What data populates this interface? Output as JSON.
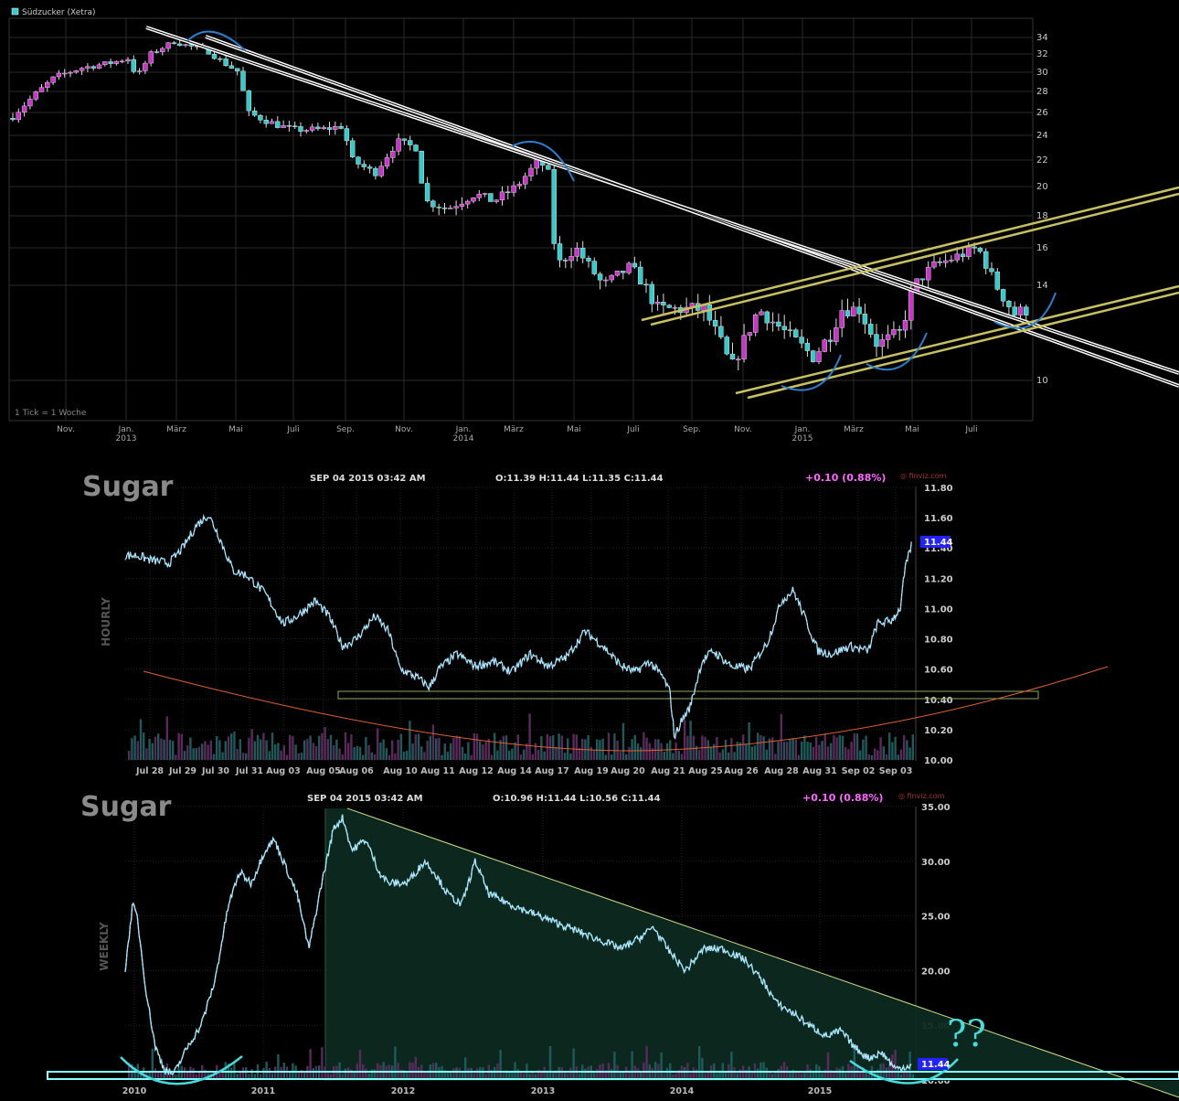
{
  "panel1": {
    "legend": "Südzucker (Xetra)",
    "note": "1 Tick = 1 Woche",
    "y_ticks": [
      "34",
      "32",
      "30",
      "28",
      "26",
      "24",
      "22",
      "20",
      "18",
      "16",
      "14",
      "10"
    ],
    "x_ticks": [
      "Nov.",
      "Jan.",
      "März",
      "Mai",
      "Juli",
      "Sep.",
      "Nov.",
      "Jan.",
      "März",
      "Mai",
      "Juli",
      "Sep.",
      "Nov.",
      "Jan.",
      "März",
      "Mai",
      "Juli"
    ],
    "x_years": [
      "2013",
      "2014",
      "2015"
    ]
  },
  "panel2": {
    "title": "Sugar",
    "date": "SEP 04 2015 03:42 AM",
    "ohlc": "O:11.39    H:11.44    L:11.35    C:11.44",
    "change": "+0.10 (0.88%)",
    "brand": "finviz.com",
    "side_label": "HOURLY",
    "last_badge": "11.44",
    "y_ticks": [
      "11.80",
      "11.60",
      "11.40",
      "11.20",
      "11.00",
      "10.80",
      "10.60",
      "10.40",
      "10.20",
      "10.00"
    ],
    "x_ticks": [
      "Jul 28",
      "Jul 29",
      "Jul 30",
      "Jul 31",
      "Aug 03",
      "Aug 05",
      "Aug 06",
      "Aug 10",
      "Aug 11",
      "Aug 12",
      "Aug 14",
      "Aug 17",
      "Aug 19",
      "Aug 20",
      "Aug 21",
      "Aug 25",
      "Aug 26",
      "Aug 28",
      "Aug 31",
      "Sep 02",
      "Sep 03"
    ]
  },
  "panel3": {
    "title": "Sugar",
    "date": "SEP 04 2015 03:42 AM",
    "ohlc": "O:10.96    H:11.44    L:10.56    C:11.44",
    "change": "+0.10 (0.88%)",
    "brand": "finviz.com",
    "side_label": "WEEKLY",
    "last_badge": "11.44",
    "annotation": "??",
    "y_ticks": [
      "35.00",
      "30.00",
      "25.00",
      "20.00",
      "15.00",
      "10.00"
    ],
    "x_ticks": [
      "2010",
      "2011",
      "2012",
      "2013",
      "2014",
      "2015"
    ]
  },
  "colors": {
    "up": "#ff66ff",
    "down": "#66ffff",
    "cyan_candle": "#3cc",
    "magenta_candle": "#c3c",
    "trend_white": "#ffffff",
    "channel_yellow": "#c8c060",
    "curve_blue": "#2a7fd0",
    "support_green": "#88aa66",
    "parabola": "#e06030",
    "change_text": "#ff66ff"
  },
  "chart_data": [
    {
      "type": "candlestick",
      "title": "Südzucker (Xetra)",
      "ylim": [
        9,
        35
      ],
      "x": [
        "Nov. 2012",
        "Jan. 2013",
        "März",
        "Mai",
        "Juli",
        "Sep.",
        "Nov.",
        "Jan. 2014",
        "März",
        "Mai",
        "Juli",
        "Sep.",
        "Nov.",
        "Jan. 2015",
        "März",
        "Mai",
        "Juli",
        "Sep."
      ],
      "values": [
        25.5,
        31,
        33.5,
        28,
        25,
        22,
        23,
        19,
        22,
        15,
        14,
        13,
        10.5,
        11,
        13,
        14,
        16,
        12.5
      ]
    },
    {
      "type": "line",
      "title": "Sugar",
      "ylim": [
        10.0,
        11.8
      ],
      "x": [
        "Jul 28",
        "Jul 29",
        "Jul 30",
        "Jul 31",
        "Aug 03",
        "Aug 05",
        "Aug 06",
        "Aug 10",
        "Aug 11",
        "Aug 12",
        "Aug 14",
        "Aug 17",
        "Aug 19",
        "Aug 20",
        "Aug 21",
        "Aug 25",
        "Aug 26",
        "Aug 28",
        "Aug 31",
        "Sep 02",
        "Sep 03"
      ],
      "values": [
        11.35,
        11.3,
        11.6,
        11.25,
        10.9,
        10.95,
        10.75,
        10.85,
        10.5,
        10.65,
        10.62,
        10.68,
        10.7,
        10.55,
        10.25,
        10.65,
        10.6,
        11.1,
        10.7,
        10.8,
        11.44
      ]
    },
    {
      "type": "line",
      "title": "Sugar",
      "ylim": [
        10.0,
        35.0
      ],
      "x": [
        "2010",
        "2011",
        "2012",
        "2013",
        "2014",
        "2015"
      ],
      "values": [
        26,
        13,
        33,
        28,
        24,
        18,
        14,
        11.44
      ]
    }
  ]
}
